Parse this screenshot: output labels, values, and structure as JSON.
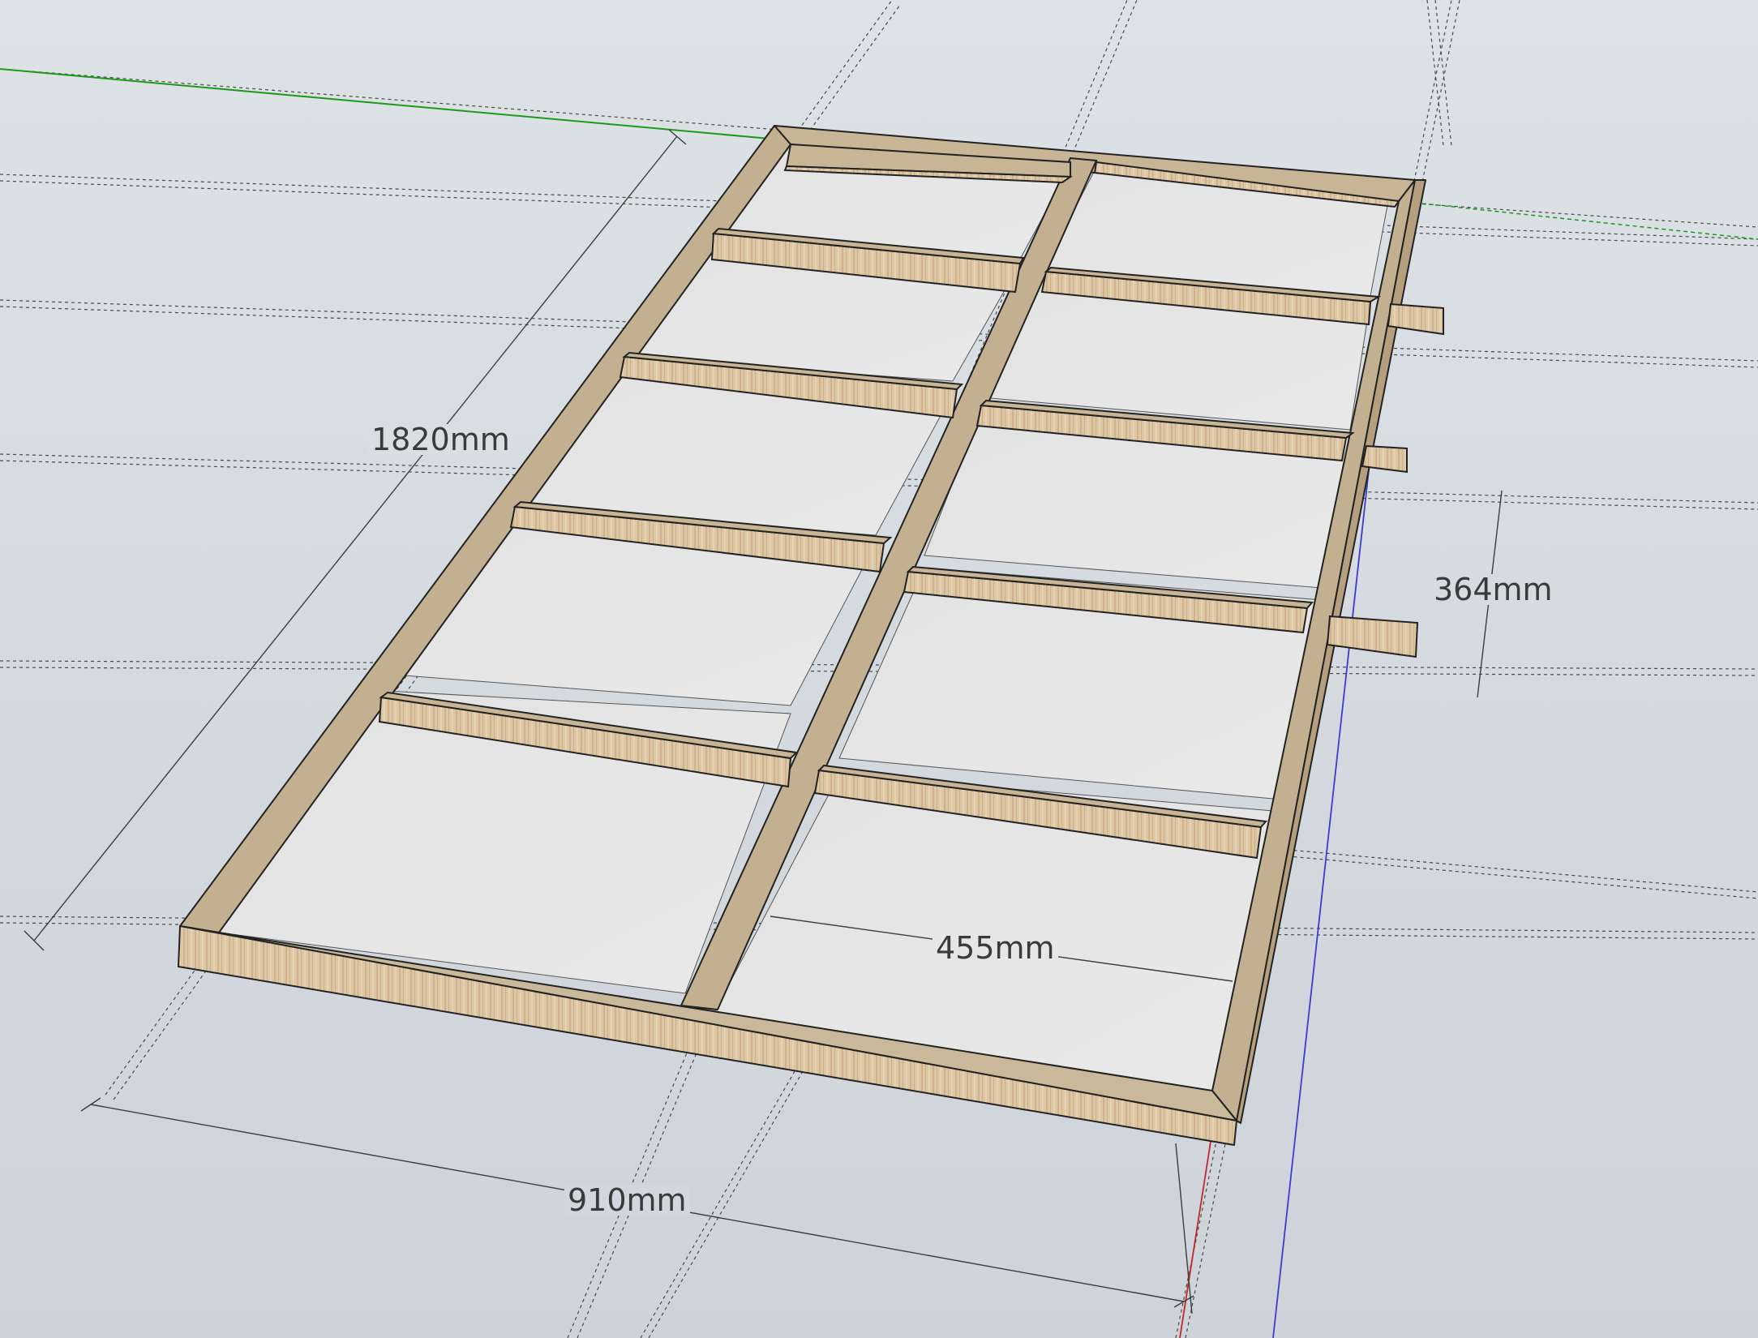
{
  "dimensions": {
    "length": "1820mm",
    "width": "910mm",
    "cell_width": "455mm",
    "spacing": "364mm"
  },
  "colors": {
    "background": "#d6dbe0",
    "wood_top": "#c9b89c",
    "wood_side": "#d8c1a0",
    "board": "#e4e4e4",
    "guide_line": "#3c3c3c",
    "axis_green": "#1a9a1a",
    "axis_blue": "#3b3bd0",
    "axis_red": "#c0282c"
  }
}
